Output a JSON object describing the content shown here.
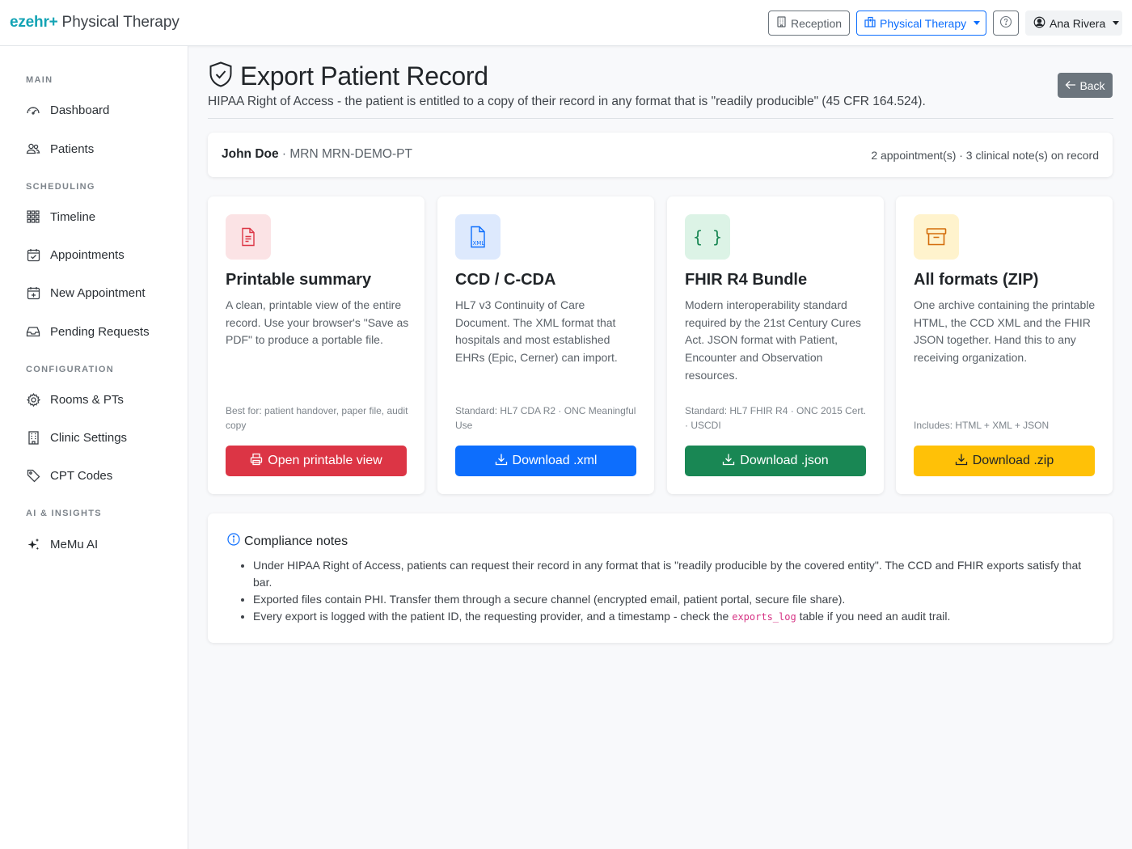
{
  "header": {
    "logo": "ezehr+",
    "app_name": "Physical Therapy",
    "reception_label": "Reception",
    "department_label": "Physical Therapy",
    "user_name": "Ana Rivera"
  },
  "sidebar": {
    "sections": [
      {
        "label": "MAIN",
        "items": [
          {
            "label": "Dashboard",
            "icon": "speedometer-icon"
          },
          {
            "label": "Patients",
            "icon": "people-icon"
          }
        ]
      },
      {
        "label": "SCHEDULING",
        "items": [
          {
            "label": "Timeline",
            "icon": "grid-icon"
          },
          {
            "label": "Appointments",
            "icon": "calendar-check-icon"
          },
          {
            "label": "New Appointment",
            "icon": "calendar-plus-icon"
          },
          {
            "label": "Pending Requests",
            "icon": "inbox-icon"
          }
        ]
      },
      {
        "label": "CONFIGURATION",
        "items": [
          {
            "label": "Rooms & PTs",
            "icon": "gear-icon"
          },
          {
            "label": "Clinic Settings",
            "icon": "building-icon"
          },
          {
            "label": "CPT Codes",
            "icon": "tag-icon"
          }
        ]
      },
      {
        "label": "AI & INSIGHTS",
        "items": [
          {
            "label": "MeMu AI",
            "icon": "sparkles-icon"
          }
        ]
      }
    ]
  },
  "page": {
    "title": "Export Patient Record",
    "subtitle": "HIPAA Right of Access - the patient is entitled to a copy of their record in any format that is \"readily producible\" (45 CFR 164.524).",
    "back_label": "Back"
  },
  "patient": {
    "name": "John Doe",
    "mrn": " · MRN MRN-DEMO-PT",
    "counts": "2 appointment(s) · 3 clinical note(s) on record"
  },
  "formats": [
    {
      "title": "Printable summary",
      "desc": "A clean, printable view of the entire record. Use your browser's \"Save as PDF\" to produce a portable file.",
      "meta": "Best for: patient handover, paper file, audit copy",
      "button": "Open printable view",
      "color": "#dc3545",
      "badge_bg": "#fbe3e5",
      "icon": "file-text-icon"
    },
    {
      "title": "CCD / C-CDA",
      "desc": "HL7 v3 Continuity of Care Document. The XML format that hospitals and most established EHRs (Epic, Cerner) can import.",
      "meta": "Standard: HL7 CDA R2 · ONC Meaningful Use",
      "button": "Download .xml",
      "color": "#0d6efd",
      "badge_bg": "#dde9fd",
      "icon": "file-xml-icon"
    },
    {
      "title": "FHIR R4 Bundle",
      "desc": "Modern interoperability standard required by the 21st Century Cures Act. JSON format with Patient, Encounter and Observation resources.",
      "meta": "Standard: HL7 FHIR R4 · ONC 2015 Cert. · USCDI",
      "button": "Download .json",
      "color": "#198754",
      "badge_bg": "#dcf3e6",
      "icon": "braces-icon"
    },
    {
      "title": "All formats (ZIP)",
      "desc": "One archive containing the printable HTML, the CCD XML and the FHIR JSON together. Hand this to any receiving organization.",
      "meta": "Includes: HTML + XML + JSON",
      "button": "Download .zip",
      "color": "#ffc107",
      "badge_bg": "#fff3cd",
      "icon": "archive-icon"
    }
  ],
  "compliance": {
    "title": "Compliance notes",
    "notes": [
      "Under HIPAA Right of Access, patients can request their record in any format that is \"readily producible by the covered entity\". The CCD and FHIR exports satisfy that bar.",
      "Exported files contain PHI. Transfer them through a secure channel (encrypted email, patient portal, secure file share).",
      "Every export is logged with the patient ID, the requesting provider, and a timestamp - check the "
    ],
    "code": "exports_log",
    "note3_suffix": " table if you need an audit trail."
  }
}
